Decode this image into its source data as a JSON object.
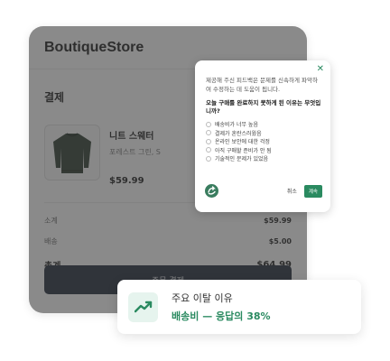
{
  "store": {
    "brand": "BoutiqueStore",
    "section_title": "결제",
    "product": {
      "name": "니트 스웨터",
      "variant": "포레스트 그린, S",
      "price": "$59.99",
      "image_icon": "sweater-icon"
    },
    "summary": {
      "subtotal_label": "소계",
      "subtotal_value": "$59.99",
      "shipping_label": "배송",
      "shipping_value": "$5.00",
      "total_label": "총계",
      "total_value": "$64.99"
    },
    "checkout_label": "주문 결제"
  },
  "survey": {
    "intro": "제공해 주신 피드백은 문제를 신속하게 파악하여 수정하는 데 도움이 됩니다.",
    "question": "오늘 구매를 완료하지 못하게 된 이유는 무엇입니까?",
    "options": [
      "배송비가 너무 높음",
      "결제가 혼란스러웠음",
      "온라인 보안에 대한 걱정",
      "아직 구매할 준비가 안 됨",
      "기술적인 문제가 있었음"
    ],
    "cancel_label": "취소",
    "continue_label": "계속"
  },
  "insight": {
    "label": "주요 이탈 이유",
    "value": "배송비 — 응답의 38%",
    "icon": "trend-icon"
  },
  "colors": {
    "accent": "#2a8a60",
    "button_dark": "#1f2937",
    "overlay": "#3c3c3c"
  }
}
